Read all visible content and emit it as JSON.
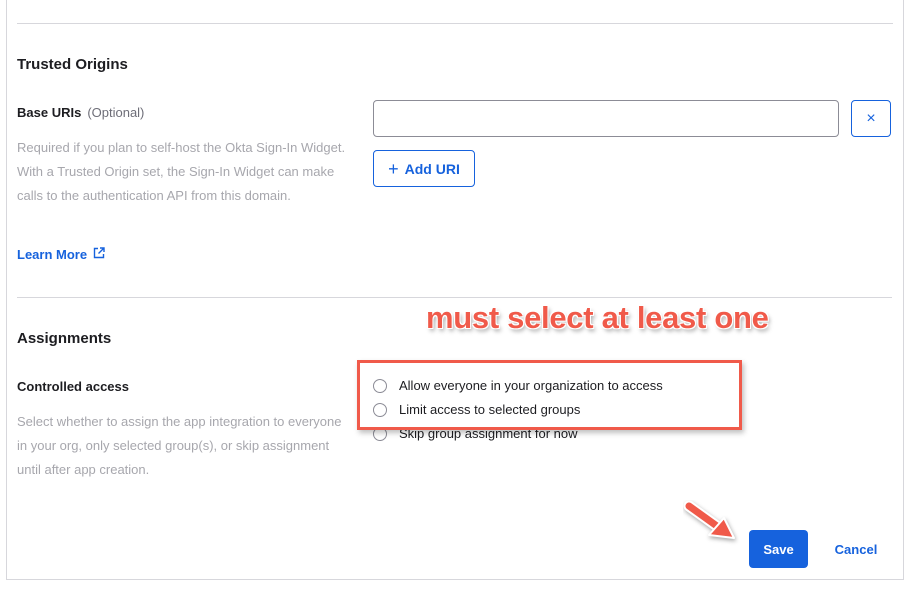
{
  "trusted_origins": {
    "title": "Trusted Origins",
    "base_uris_label": "Base URIs",
    "base_uris_optional": "(Optional)",
    "help_text": "Required if you plan to self-host the Okta Sign-In Widget. With a Trusted Origin set, the Sign-In Widget can make calls to the authentication API from this domain.",
    "learn_more_label": "Learn More",
    "uri_input_value": "",
    "uri_input_placeholder": "",
    "clear_icon": "×",
    "add_uri_icon": "+",
    "add_uri_label": "Add URI"
  },
  "assignments": {
    "title": "Assignments",
    "controlled_access_label": "Controlled access",
    "help_text": "Select whether to assign the app integration to everyone in your org, only selected group(s), or skip assignment until after app creation.",
    "options": [
      {
        "label": "Allow everyone in your organization to access",
        "selected": false
      },
      {
        "label": "Limit access to selected groups",
        "selected": false
      },
      {
        "label": "Skip group assignment for now",
        "selected": false
      }
    ]
  },
  "annotation": {
    "text": "must select at least one",
    "color": "#f05a4a"
  },
  "footer": {
    "save_label": "Save",
    "cancel_label": "Cancel"
  },
  "colors": {
    "primary": "#1662dd",
    "annotation": "#f05a4a"
  }
}
